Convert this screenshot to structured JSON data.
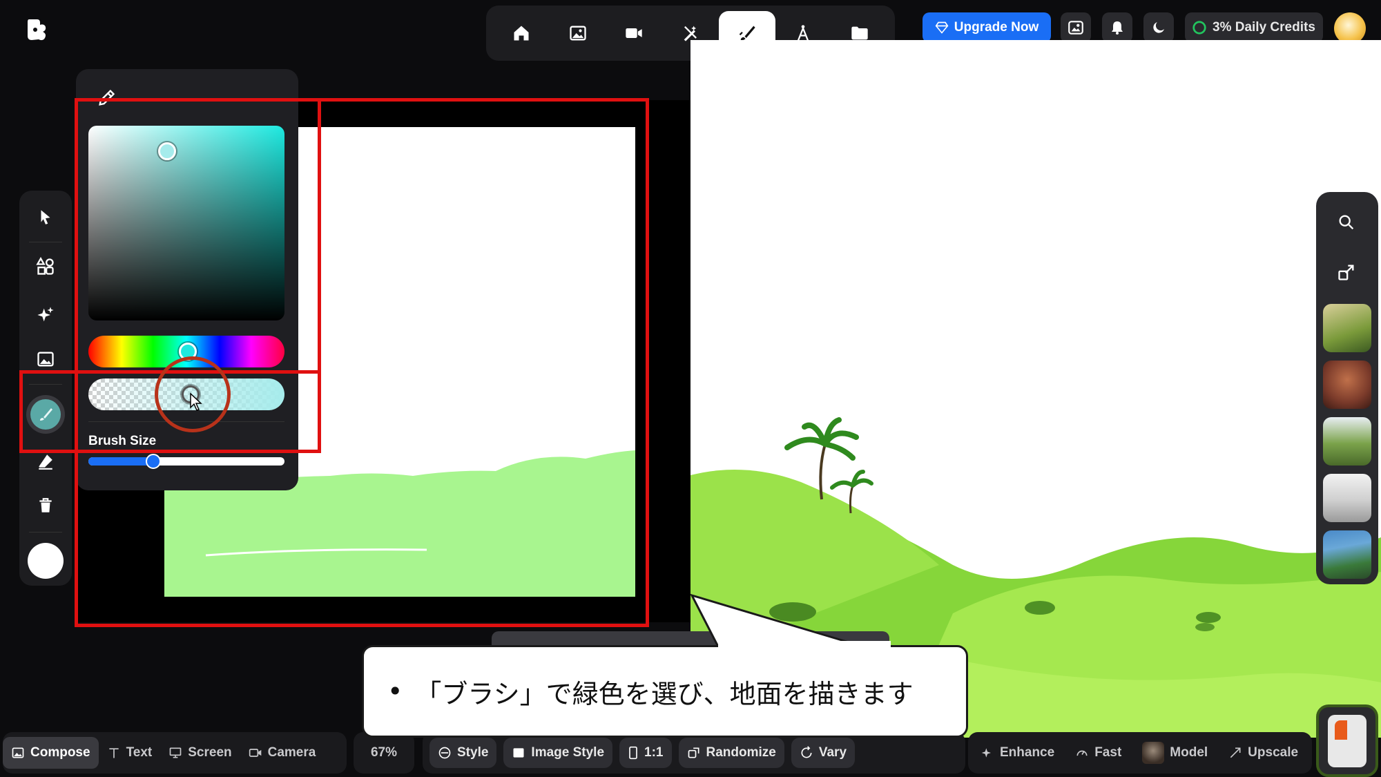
{
  "header": {
    "nav_items": [
      "home",
      "image",
      "video",
      "edit",
      "paint",
      "design",
      "folder"
    ],
    "active_nav": "paint",
    "upgrade_label": "Upgrade Now",
    "credits_label": "3% Daily Credits"
  },
  "picker": {
    "selected_color": "#1de9e0",
    "alpha_color": "#a6ecec",
    "brush_size_label": "Brush Size",
    "brush_size": 0.33
  },
  "canvas": {
    "ground_color": "#a8f58f"
  },
  "bottom": {
    "left_tabs": [
      "Compose",
      "Text",
      "Screen",
      "Camera"
    ],
    "active_tab": "Compose",
    "zoom": "67%",
    "center_pills": [
      "Style",
      "Image Style",
      "1:1",
      "Randomize",
      "Vary"
    ],
    "right_items": [
      "Enhance",
      "Fast",
      "Model",
      "Upscale"
    ]
  },
  "caption": {
    "bullet": "•",
    "text": "「ブラシ」で緑色を選び、地面を描きます"
  },
  "colors": {
    "accent": "#1a6ef5",
    "highlight": "#e01010",
    "panel": "#1d1d20"
  }
}
